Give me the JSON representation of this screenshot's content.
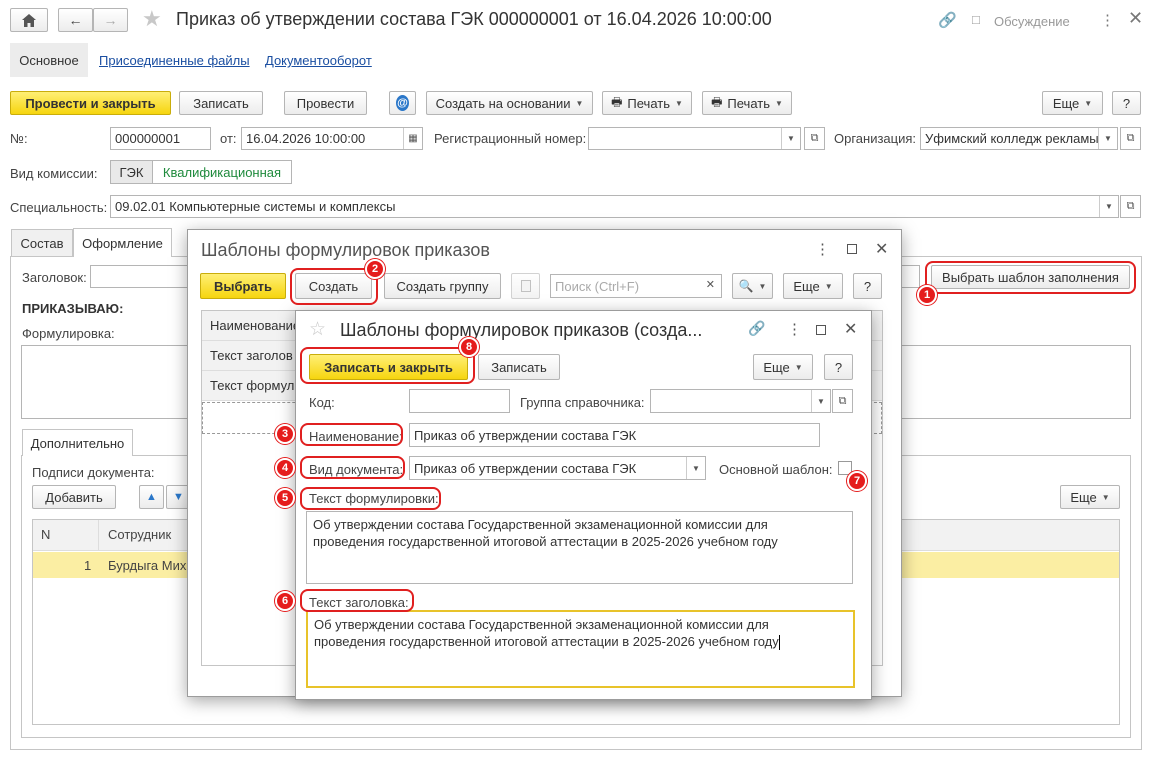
{
  "window": {
    "title": "Приказ об утверждении состава ГЭК 000000001 от 16.04.2026 10:00:00",
    "discussion": "Обсуждение"
  },
  "tabs": [
    "Основное",
    "Присоединенные файлы",
    "Документооборот"
  ],
  "toolbar": {
    "post_close": "Провести и закрыть",
    "save": "Записать",
    "post": "Провести",
    "create_based": "Создать на основании",
    "print1": "Печать",
    "print2": "Печать",
    "more": "Еще",
    "help": "?"
  },
  "header": {
    "number_label": "№:",
    "number": "000000001",
    "date_label": "от:",
    "date": "16.04.2026 10:00:00",
    "reg_label": "Регистрационный номер:",
    "reg_value": "",
    "org_label": "Организация:",
    "org_value": "Уфимский колледж рекламы",
    "commission_label": "Вид комиссии:",
    "commission_options": [
      "ГЭК",
      "Квалификационная"
    ],
    "specialty_label": "Специальность:",
    "specialty_value": "09.02.01 Компьютерные системы и комплексы"
  },
  "inner_tabs": [
    "Состав",
    "Оформление"
  ],
  "design": {
    "heading_label": "Заголовок:",
    "choose_template": "Выбрать шаблон заполнения",
    "order_text": "ПРИКАЗЫВАЮ:",
    "wording_label": "Формулировка:",
    "extra_tab": "Дополнительно",
    "signatures_label": "Подписи документа:",
    "add": "Добавить",
    "more": "Еще",
    "table_headers": [
      "N",
      "Сотрудник"
    ],
    "table_rows": [
      {
        "n": "1",
        "employee": "Бурдыга Мих"
      }
    ]
  },
  "list_dialog": {
    "title": "Шаблоны формулировок приказов",
    "select": "Выбрать",
    "create": "Создать",
    "create_group": "Создать группу",
    "search_placeholder": "Поиск (Ctrl+F)",
    "more": "Еще",
    "help": "?",
    "columns": [
      "Наименование",
      "Текст заголов",
      "Текст формули"
    ]
  },
  "edit_dialog": {
    "title": "Шаблоны формулировок приказов (созда...",
    "save_close": "Записать и закрыть",
    "save": "Записать",
    "more": "Еще",
    "help": "?",
    "code_label": "Код:",
    "code_value": "",
    "group_label": "Группа справочника:",
    "group_value": "",
    "name_label": "Наименование:",
    "name_value": "Приказ об утверждении состава ГЭК",
    "doctype_label": "Вид документа:",
    "doctype_value": "Приказ об утверждении состава ГЭК",
    "main_template_label": "Основной шаблон:",
    "wording_label": "Текст формулировки:",
    "wording_line1": "Об утверждении состава Государственной экзаменационной комиссии для",
    "wording_line2": "проведения государственной итоговой аттестации в 2025-2026 учебном году",
    "heading_label": "Текст заголовка:",
    "heading_line1": "Об утверждении состава Государственной экзаменационной комиссии для",
    "heading_line2": "проведения государственной итоговой аттестации в 2025-2026 учебном году"
  },
  "badges": [
    "1",
    "2",
    "3",
    "4",
    "5",
    "6",
    "7",
    "8"
  ],
  "colors": {
    "accent_yellow": "#f6d50f",
    "annotation_red": "#e02020",
    "row_highlight": "#fbeea3",
    "link": "#1a4ea1"
  }
}
